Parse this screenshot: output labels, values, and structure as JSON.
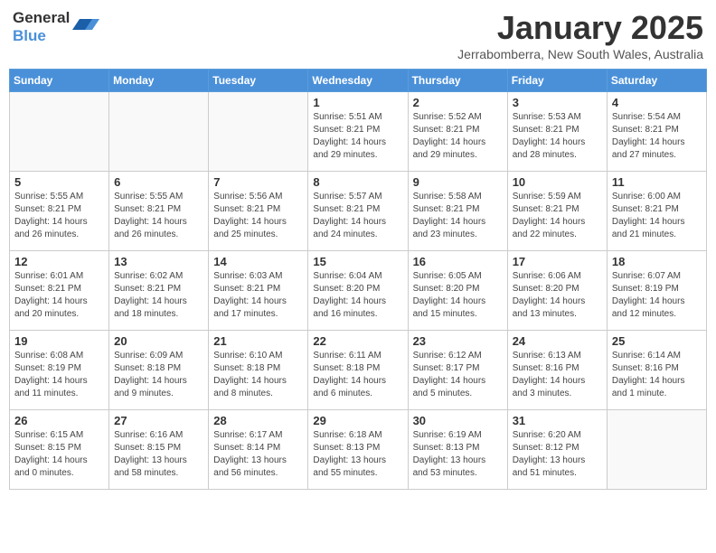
{
  "logo": {
    "line1": "General",
    "line2": "Blue"
  },
  "title": "January 2025",
  "location": "Jerrabomberra, New South Wales, Australia",
  "days_of_week": [
    "Sunday",
    "Monday",
    "Tuesday",
    "Wednesday",
    "Thursday",
    "Friday",
    "Saturday"
  ],
  "weeks": [
    [
      {
        "day": "",
        "info": ""
      },
      {
        "day": "",
        "info": ""
      },
      {
        "day": "",
        "info": ""
      },
      {
        "day": "1",
        "info": "Sunrise: 5:51 AM\nSunset: 8:21 PM\nDaylight: 14 hours\nand 29 minutes."
      },
      {
        "day": "2",
        "info": "Sunrise: 5:52 AM\nSunset: 8:21 PM\nDaylight: 14 hours\nand 29 minutes."
      },
      {
        "day": "3",
        "info": "Sunrise: 5:53 AM\nSunset: 8:21 PM\nDaylight: 14 hours\nand 28 minutes."
      },
      {
        "day": "4",
        "info": "Sunrise: 5:54 AM\nSunset: 8:21 PM\nDaylight: 14 hours\nand 27 minutes."
      }
    ],
    [
      {
        "day": "5",
        "info": "Sunrise: 5:55 AM\nSunset: 8:21 PM\nDaylight: 14 hours\nand 26 minutes."
      },
      {
        "day": "6",
        "info": "Sunrise: 5:55 AM\nSunset: 8:21 PM\nDaylight: 14 hours\nand 26 minutes."
      },
      {
        "day": "7",
        "info": "Sunrise: 5:56 AM\nSunset: 8:21 PM\nDaylight: 14 hours\nand 25 minutes."
      },
      {
        "day": "8",
        "info": "Sunrise: 5:57 AM\nSunset: 8:21 PM\nDaylight: 14 hours\nand 24 minutes."
      },
      {
        "day": "9",
        "info": "Sunrise: 5:58 AM\nSunset: 8:21 PM\nDaylight: 14 hours\nand 23 minutes."
      },
      {
        "day": "10",
        "info": "Sunrise: 5:59 AM\nSunset: 8:21 PM\nDaylight: 14 hours\nand 22 minutes."
      },
      {
        "day": "11",
        "info": "Sunrise: 6:00 AM\nSunset: 8:21 PM\nDaylight: 14 hours\nand 21 minutes."
      }
    ],
    [
      {
        "day": "12",
        "info": "Sunrise: 6:01 AM\nSunset: 8:21 PM\nDaylight: 14 hours\nand 20 minutes."
      },
      {
        "day": "13",
        "info": "Sunrise: 6:02 AM\nSunset: 8:21 PM\nDaylight: 14 hours\nand 18 minutes."
      },
      {
        "day": "14",
        "info": "Sunrise: 6:03 AM\nSunset: 8:21 PM\nDaylight: 14 hours\nand 17 minutes."
      },
      {
        "day": "15",
        "info": "Sunrise: 6:04 AM\nSunset: 8:20 PM\nDaylight: 14 hours\nand 16 minutes."
      },
      {
        "day": "16",
        "info": "Sunrise: 6:05 AM\nSunset: 8:20 PM\nDaylight: 14 hours\nand 15 minutes."
      },
      {
        "day": "17",
        "info": "Sunrise: 6:06 AM\nSunset: 8:20 PM\nDaylight: 14 hours\nand 13 minutes."
      },
      {
        "day": "18",
        "info": "Sunrise: 6:07 AM\nSunset: 8:19 PM\nDaylight: 14 hours\nand 12 minutes."
      }
    ],
    [
      {
        "day": "19",
        "info": "Sunrise: 6:08 AM\nSunset: 8:19 PM\nDaylight: 14 hours\nand 11 minutes."
      },
      {
        "day": "20",
        "info": "Sunrise: 6:09 AM\nSunset: 8:18 PM\nDaylight: 14 hours\nand 9 minutes."
      },
      {
        "day": "21",
        "info": "Sunrise: 6:10 AM\nSunset: 8:18 PM\nDaylight: 14 hours\nand 8 minutes."
      },
      {
        "day": "22",
        "info": "Sunrise: 6:11 AM\nSunset: 8:18 PM\nDaylight: 14 hours\nand 6 minutes."
      },
      {
        "day": "23",
        "info": "Sunrise: 6:12 AM\nSunset: 8:17 PM\nDaylight: 14 hours\nand 5 minutes."
      },
      {
        "day": "24",
        "info": "Sunrise: 6:13 AM\nSunset: 8:16 PM\nDaylight: 14 hours\nand 3 minutes."
      },
      {
        "day": "25",
        "info": "Sunrise: 6:14 AM\nSunset: 8:16 PM\nDaylight: 14 hours\nand 1 minute."
      }
    ],
    [
      {
        "day": "26",
        "info": "Sunrise: 6:15 AM\nSunset: 8:15 PM\nDaylight: 14 hours\nand 0 minutes."
      },
      {
        "day": "27",
        "info": "Sunrise: 6:16 AM\nSunset: 8:15 PM\nDaylight: 13 hours\nand 58 minutes."
      },
      {
        "day": "28",
        "info": "Sunrise: 6:17 AM\nSunset: 8:14 PM\nDaylight: 13 hours\nand 56 minutes."
      },
      {
        "day": "29",
        "info": "Sunrise: 6:18 AM\nSunset: 8:13 PM\nDaylight: 13 hours\nand 55 minutes."
      },
      {
        "day": "30",
        "info": "Sunrise: 6:19 AM\nSunset: 8:13 PM\nDaylight: 13 hours\nand 53 minutes."
      },
      {
        "day": "31",
        "info": "Sunrise: 6:20 AM\nSunset: 8:12 PM\nDaylight: 13 hours\nand 51 minutes."
      },
      {
        "day": "",
        "info": ""
      }
    ]
  ]
}
